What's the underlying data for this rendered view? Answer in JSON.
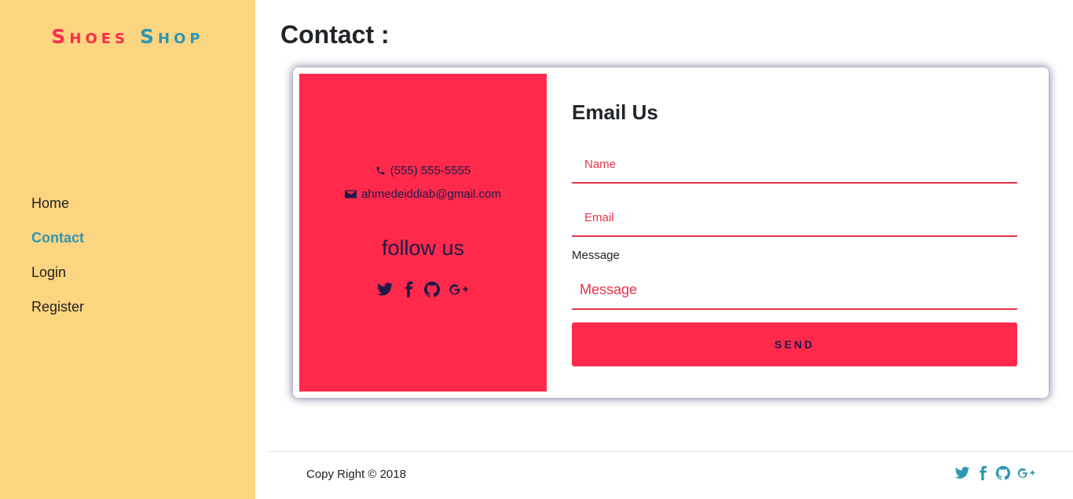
{
  "brand": {
    "word1_first": "S",
    "word1_rest": "HOES",
    "word2_first": "S",
    "word2_rest": "HOP"
  },
  "nav": [
    {
      "label": "Home",
      "active": false
    },
    {
      "label": "Contact",
      "active": true
    },
    {
      "label": "Login",
      "active": false
    },
    {
      "label": "Register",
      "active": false
    }
  ],
  "page": {
    "title": "Contact :"
  },
  "contact_info": {
    "phone": "(555) 555-5555",
    "email": "ahmedeiddiab@gmail.com",
    "follow_heading": "follow us",
    "social_icons": [
      "twitter-icon",
      "facebook-icon",
      "github-icon",
      "google-plus-icon"
    ]
  },
  "form": {
    "title": "Email Us",
    "name_placeholder": "Name",
    "email_placeholder": "Email",
    "message_label": "Message",
    "message_placeholder": "Message",
    "send_label": "SEND"
  },
  "footer": {
    "copyright": "Copy Right © 2018",
    "social_icons": [
      "twitter-icon",
      "facebook-icon",
      "github-icon",
      "google-plus-icon"
    ]
  },
  "colors": {
    "sidebar_bg": "#fcd581",
    "accent_red": "#ff2a4b",
    "accent_teal": "#2c97b3",
    "navy": "#1d1a4a"
  }
}
